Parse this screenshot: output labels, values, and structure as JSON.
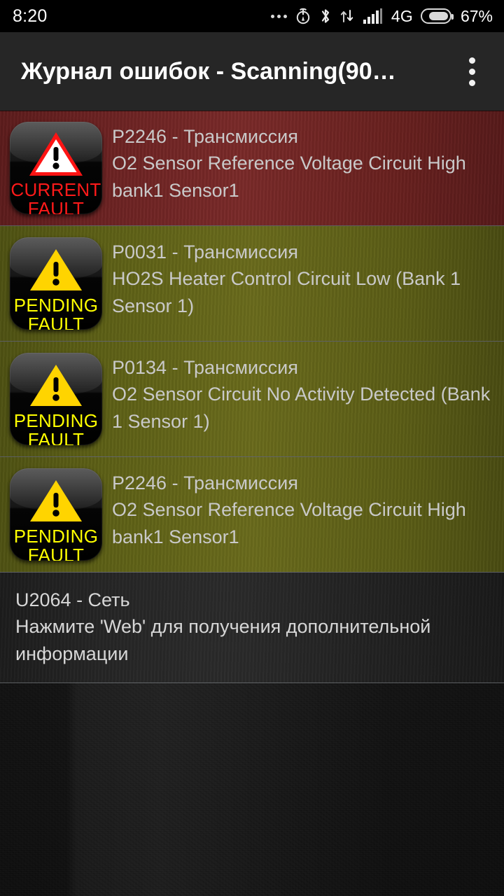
{
  "status_bar": {
    "time": "8:20",
    "icons": [
      "more-dots-icon",
      "alarm-icon",
      "bluetooth-icon",
      "data-transfer-icon",
      "signal-bars-icon"
    ],
    "network": "4G",
    "battery_percent": "67%",
    "battery_level": 67
  },
  "app_bar": {
    "title": "Журнал ошибок - Scanning(90…",
    "overflow_menu": "overflow-menu-icon"
  },
  "colors": {
    "current_fault_bg": "#6b2222",
    "pending_fault_bg": "#5d6016",
    "info_bg": "#262626",
    "current_fault_text": "#ff1a1a",
    "pending_fault_text": "#ffff00",
    "body_text": "#c9c9c9",
    "app_bar_bg": "#262626"
  },
  "fault_list": [
    {
      "severity": "current",
      "badge_line1": "CURRENT",
      "badge_line2": "FAULT",
      "code": "P2246 - Трансмиссия",
      "description": "O2 Sensor Reference Voltage Circuit High bank1 Sensor1"
    },
    {
      "severity": "pending",
      "badge_line1": "PENDING",
      "badge_line2": "FAULT",
      "code": "P0031 - Трансмиссия",
      "description": "HO2S Heater Control Circuit Low (Bank 1 Sensor 1)"
    },
    {
      "severity": "pending",
      "badge_line1": "PENDING",
      "badge_line2": "FAULT",
      "code": "P0134 - Трансмиссия",
      "description": "O2 Sensor Circuit No Activity Detected (Bank 1 Sensor 1)"
    },
    {
      "severity": "pending",
      "badge_line1": "PENDING",
      "badge_line2": "FAULT",
      "code": "P2246 - Трансмиссия",
      "description": "O2 Sensor Reference Voltage Circuit High bank1 Sensor1"
    }
  ],
  "info_row": {
    "code": "U2064 - Сеть",
    "description": "Нажмите 'Web' для получения дополнительной информации"
  }
}
